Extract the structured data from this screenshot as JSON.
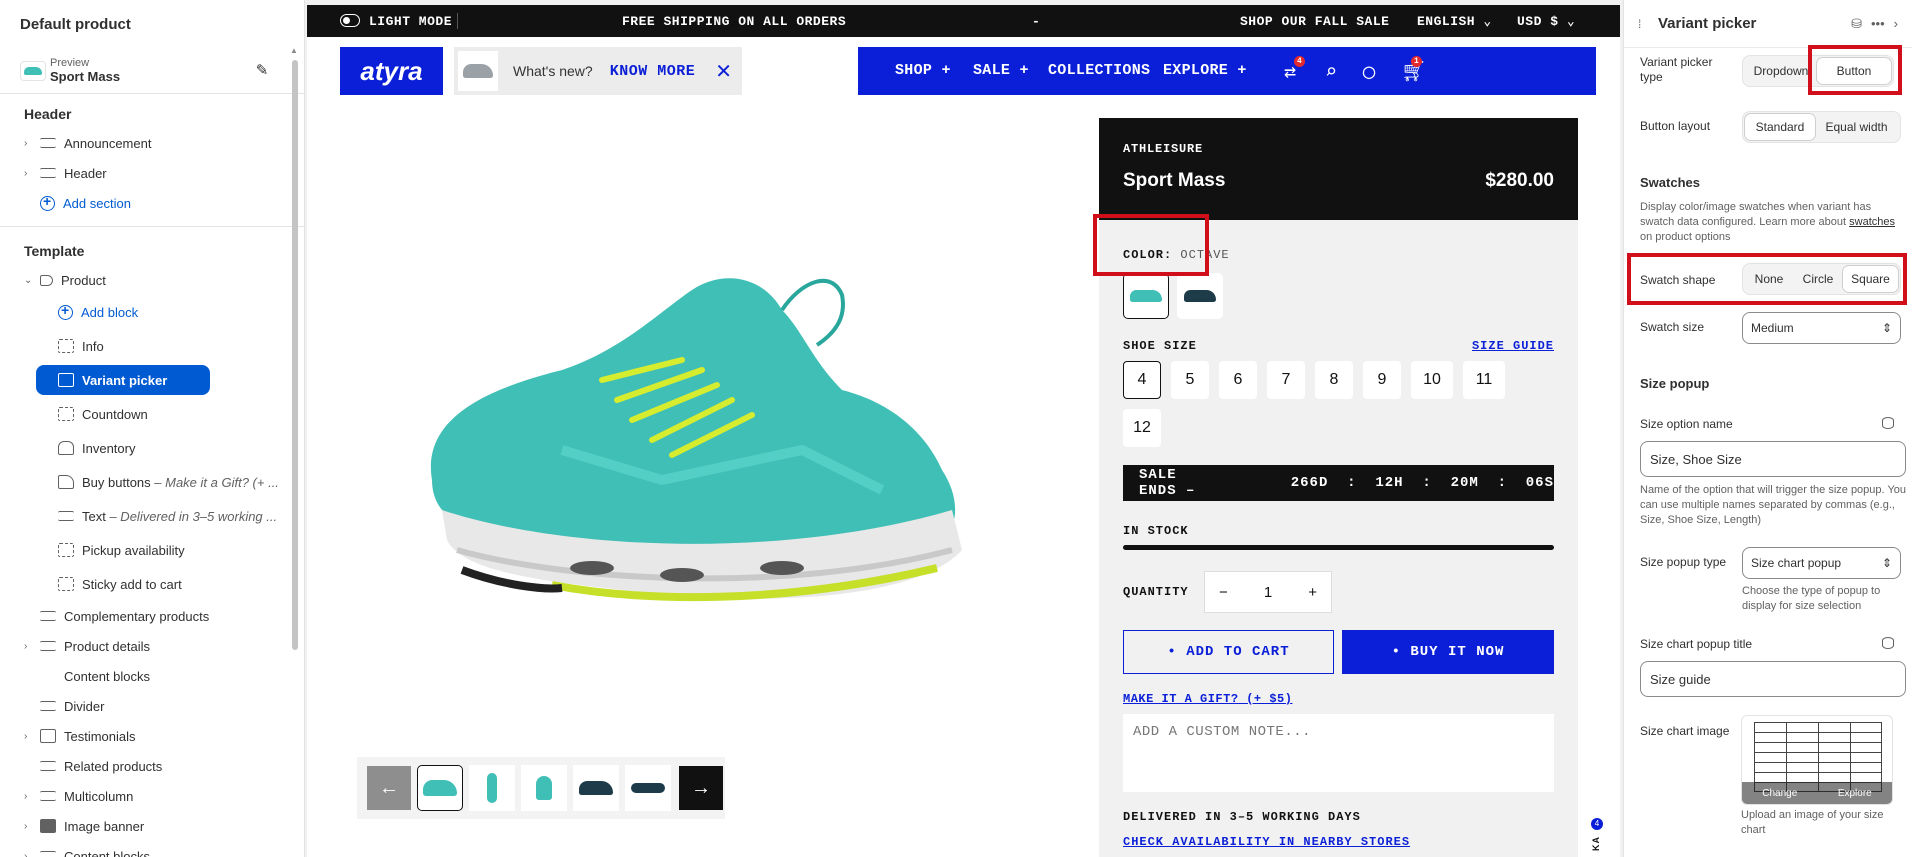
{
  "left": {
    "title": "Default product",
    "preview_label": "Preview",
    "preview_name": "Sport Mass",
    "header_group": "Header",
    "header_items": [
      "Announcement",
      "Header"
    ],
    "add_section": "Add section",
    "template_group": "Template",
    "product": "Product",
    "add_block": "Add block",
    "blocks": {
      "info": "Info",
      "variant_picker": "Variant picker",
      "countdown": "Countdown",
      "inventory": "Inventory",
      "buy_buttons": "Buy buttons",
      "buy_buttons_note": "– Make it a Gift? (+ ...",
      "text": "Text",
      "text_note": "– Delivered in 3–5 working ...",
      "pickup": "Pickup availability",
      "sticky": "Sticky add to cart"
    },
    "sections": [
      "Complementary products",
      "Product details",
      "Content blocks",
      "Divider",
      "Testimonials",
      "Related products",
      "Multicolumn",
      "Image banner",
      "Content blocks"
    ]
  },
  "store": {
    "light_mode": "LIGHT MODE",
    "shipping": "FREE SHIPPING ON ALL ORDERS",
    "dash": "-",
    "fall_sale": "SHOP OUR FALL SALE",
    "language": "ENGLISH",
    "currency": "USD $",
    "logo": "atyra",
    "whats_new": "What's new?",
    "know_more": "KNOW MORE",
    "nav": [
      "SHOP +",
      "SALE +",
      "COLLECTIONS",
      "EXPLORE +"
    ],
    "compare_count": "4",
    "cart_count": "1",
    "category": "ATHLEISURE",
    "product_name": "Sport Mass",
    "price": "$280.00",
    "color_label": "COLOR:",
    "color_value": "OCTAVE",
    "shoe_size": "SHOE SIZE",
    "size_guide": "SIZE GUIDE",
    "sizes": [
      "4",
      "5",
      "6",
      "7",
      "8",
      "9",
      "10",
      "11",
      "12"
    ],
    "sale_ends": "SALE ENDS –",
    "countdown": "266D  :  12H  :  20M  :  06S",
    "in_stock": "IN STOCK",
    "quantity_label": "QUANTITY",
    "quantity": "1",
    "add_to_cart": "• ADD TO CART",
    "buy_now": "• BUY IT NOW",
    "gift": "MAKE IT A GIFT? (+ $5)",
    "note_placeholder": "ADD A CUSTOM NOTE...",
    "delivered": "DELIVERED IN 3–5 WORKING DAYS",
    "check_avail": "CHECK AVAILABILITY IN NEARBY STORES",
    "side_badge": "4",
    "side_label": "KA"
  },
  "right": {
    "title": "Variant picker",
    "picker_type_label": "Variant picker type",
    "picker_type_options": [
      "Dropdown",
      "Button"
    ],
    "button_layout_label": "Button layout",
    "button_layout_options": [
      "Standard",
      "Equal width"
    ],
    "swatches_title": "Swatches",
    "swatches_help_1": "Display color/image swatches when variant has swatch data configured. Learn more about",
    "swatches_link": "swatches",
    "swatches_help_2": "on product options",
    "swatch_shape_label": "Swatch shape",
    "swatch_shape_options": [
      "None",
      "Circle",
      "Square"
    ],
    "swatch_size_label": "Swatch size",
    "swatch_size_value": "Medium",
    "size_popup_title": "Size popup",
    "size_option_label": "Size option name",
    "size_option_value": "Size, Shoe Size",
    "size_option_help": "Name of the option that will trigger the size popup. You can use multiple names separated by commas (e.g., Size, Shoe Size, Length)",
    "popup_type_label": "Size popup type",
    "popup_type_value": "Size chart popup",
    "popup_type_help": "Choose the type of popup to display for size selection",
    "chart_title_label": "Size chart popup title",
    "chart_title_value": "Size guide",
    "chart_image_label": "Size chart image",
    "chart_overlay": [
      "Change",
      "Explore"
    ],
    "chart_help": "Upload an image of your size chart"
  },
  "colors": {
    "brand_blue": "#0a1fd7",
    "admin_blue": "#005bd3",
    "highlight": "#d10f1b",
    "teal": "#3fbfb5"
  }
}
